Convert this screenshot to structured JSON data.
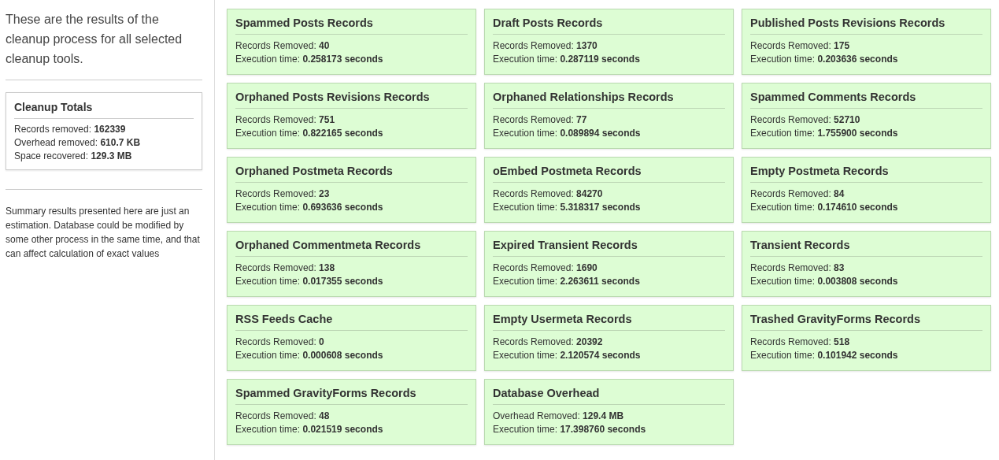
{
  "intro": "These are the results of the cleanup process for all selected cleanup tools.",
  "totals": {
    "title": "Cleanup Totals",
    "lines": [
      {
        "label": "Records removed:",
        "value": "162339"
      },
      {
        "label": "Overhead removed:",
        "value": "610.7 KB"
      },
      {
        "label": "Space recovered:",
        "value": "129.3 MB"
      }
    ]
  },
  "note": "Summary results presented here are just an estimation. Database could be modified by some other process in the same time, and that can affect calculation of exact values",
  "cards": [
    {
      "title": "Spammed Posts Records",
      "lines": [
        {
          "label": "Records Removed:",
          "value": "40"
        },
        {
          "label": "Execution time:",
          "value": "0.258173 seconds"
        }
      ]
    },
    {
      "title": "Draft Posts Records",
      "lines": [
        {
          "label": "Records Removed:",
          "value": "1370"
        },
        {
          "label": "Execution time:",
          "value": "0.287119 seconds"
        }
      ]
    },
    {
      "title": "Published Posts Revisions Records",
      "lines": [
        {
          "label": "Records Removed:",
          "value": "175"
        },
        {
          "label": "Execution time:",
          "value": "0.203636 seconds"
        }
      ]
    },
    {
      "title": "Orphaned Posts Revisions Records",
      "lines": [
        {
          "label": "Records Removed:",
          "value": "751"
        },
        {
          "label": "Execution time:",
          "value": "0.822165 seconds"
        }
      ]
    },
    {
      "title": "Orphaned Relationships Records",
      "lines": [
        {
          "label": "Records Removed:",
          "value": "77"
        },
        {
          "label": "Execution time:",
          "value": "0.089894 seconds"
        }
      ]
    },
    {
      "title": "Spammed Comments Records",
      "lines": [
        {
          "label": "Records Removed:",
          "value": "52710"
        },
        {
          "label": "Execution time:",
          "value": "1.755900 seconds"
        }
      ]
    },
    {
      "title": "Orphaned Postmeta Records",
      "lines": [
        {
          "label": "Records Removed:",
          "value": "23"
        },
        {
          "label": "Execution time:",
          "value": "0.693636 seconds"
        }
      ]
    },
    {
      "title": "oEmbed Postmeta Records",
      "lines": [
        {
          "label": "Records Removed:",
          "value": "84270"
        },
        {
          "label": "Execution time:",
          "value": "5.318317 seconds"
        }
      ]
    },
    {
      "title": "Empty Postmeta Records",
      "lines": [
        {
          "label": "Records Removed:",
          "value": "84"
        },
        {
          "label": "Execution time:",
          "value": "0.174610 seconds"
        }
      ]
    },
    {
      "title": "Orphaned Commentmeta Records",
      "lines": [
        {
          "label": "Records Removed:",
          "value": "138"
        },
        {
          "label": "Execution time:",
          "value": "0.017355 seconds"
        }
      ]
    },
    {
      "title": "Expired Transient Records",
      "lines": [
        {
          "label": "Records Removed:",
          "value": "1690"
        },
        {
          "label": "Execution time:",
          "value": "2.263611 seconds"
        }
      ]
    },
    {
      "title": "Transient Records",
      "lines": [
        {
          "label": "Records Removed:",
          "value": "83"
        },
        {
          "label": "Execution time:",
          "value": "0.003808 seconds"
        }
      ]
    },
    {
      "title": "RSS Feeds Cache",
      "lines": [
        {
          "label": "Records Removed:",
          "value": "0"
        },
        {
          "label": "Execution time:",
          "value": "0.000608 seconds"
        }
      ]
    },
    {
      "title": "Empty Usermeta Records",
      "lines": [
        {
          "label": "Records Removed:",
          "value": "20392"
        },
        {
          "label": "Execution time:",
          "value": "2.120574 seconds"
        }
      ]
    },
    {
      "title": "Trashed GravityForms Records",
      "lines": [
        {
          "label": "Records Removed:",
          "value": "518"
        },
        {
          "label": "Execution time:",
          "value": "0.101942 seconds"
        }
      ]
    },
    {
      "title": "Spammed GravityForms Records",
      "lines": [
        {
          "label": "Records Removed:",
          "value": "48"
        },
        {
          "label": "Execution time:",
          "value": "0.021519 seconds"
        }
      ]
    },
    {
      "title": "Database Overhead",
      "lines": [
        {
          "label": "Overhead Removed:",
          "value": "129.4 MB"
        },
        {
          "label": "Execution time:",
          "value": "17.398760 seconds"
        }
      ]
    }
  ]
}
